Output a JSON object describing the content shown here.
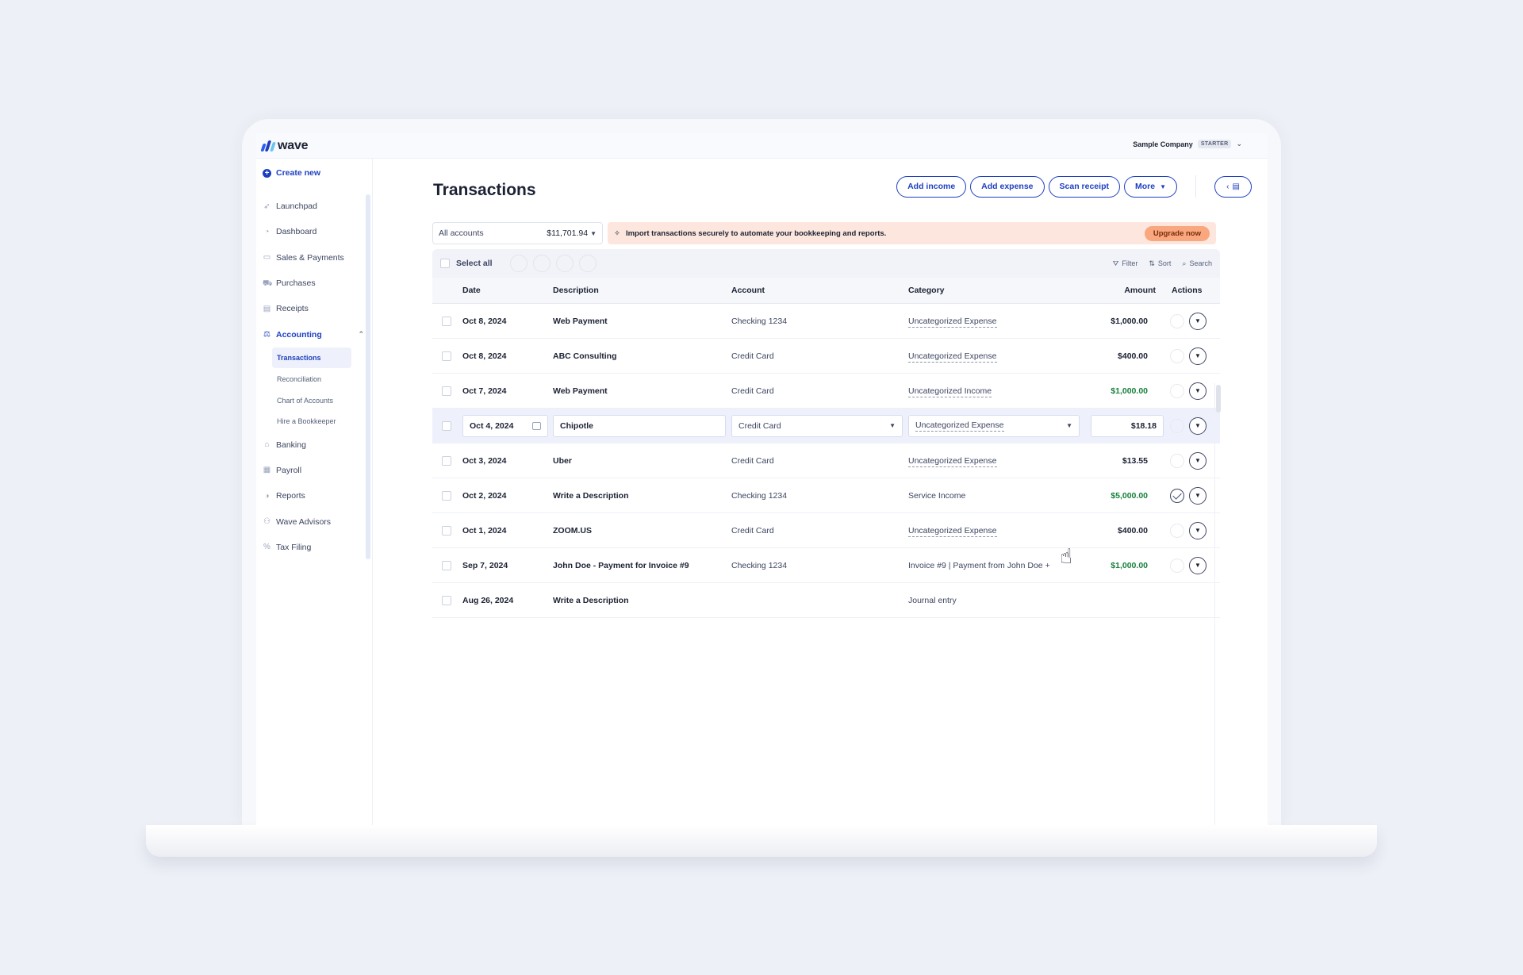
{
  "app": {
    "logo_text": "wave",
    "company": "Sample Company",
    "plan_badge": "STARTER"
  },
  "colors": {
    "accent": "#1d3fbf",
    "income_green": "#17803d",
    "banner_bg": "#fde6dd",
    "upgrade_bg": "#f9a77e"
  },
  "sidebar": {
    "create_new": "Create new",
    "items": [
      {
        "label": "Launchpad",
        "icon": "rocket-icon"
      },
      {
        "label": "Dashboard",
        "icon": "gauge-icon"
      },
      {
        "label": "Sales & Payments",
        "icon": "card-icon"
      },
      {
        "label": "Purchases",
        "icon": "cart-icon"
      },
      {
        "label": "Receipts",
        "icon": "receipt-icon"
      },
      {
        "label": "Accounting",
        "icon": "scale-icon",
        "expanded": true
      }
    ],
    "sub_items": [
      {
        "label": "Transactions",
        "active": true
      },
      {
        "label": "Reconciliation"
      },
      {
        "label": "Chart of Accounts"
      },
      {
        "label": "Hire a Bookkeeper"
      }
    ],
    "items_after": [
      {
        "label": "Banking",
        "icon": "bank-icon"
      },
      {
        "label": "Payroll",
        "icon": "clipboard-icon"
      },
      {
        "label": "Reports",
        "icon": "chart-icon"
      },
      {
        "label": "Wave Advisors",
        "icon": "people-icon"
      },
      {
        "label": "Tax Filing",
        "icon": "percent-icon"
      }
    ]
  },
  "header": {
    "title": "Transactions",
    "buttons": {
      "add_income": "Add income",
      "add_expense": "Add expense",
      "scan_receipt": "Scan receipt",
      "more": "More"
    }
  },
  "filters": {
    "account": "All accounts",
    "balance": "$11,701.94"
  },
  "banner": {
    "text": "Import transactions securely to automate your bookkeeping and reports.",
    "cta": "Upgrade now"
  },
  "table": {
    "select_all": "Select all",
    "tools": {
      "filter": "Filter",
      "sort": "Sort",
      "search": "Search"
    },
    "columns": {
      "date": "Date",
      "description": "Description",
      "account": "Account",
      "category": "Category",
      "amount": "Amount",
      "actions": "Actions"
    },
    "rows": [
      {
        "date": "Oct 8, 2024",
        "description": "Web Payment",
        "account": "Checking 1234",
        "category": "Uncategorized Expense",
        "amount": "$1,000.00",
        "income": false
      },
      {
        "date": "Oct 8, 2024",
        "description": "ABC Consulting",
        "account": "Credit Card",
        "category": "Uncategorized Expense",
        "amount": "$400.00",
        "income": false
      },
      {
        "date": "Oct 7, 2024",
        "description": "Web Payment",
        "account": "Credit Card",
        "category": "Uncategorized Income",
        "amount": "$1,000.00",
        "income": true
      },
      {
        "date": "Oct 4, 2024",
        "description": "Chipotle",
        "account": "Credit Card",
        "category": "Uncategorized Expense",
        "amount": "$18.18",
        "income": false,
        "editing": true
      },
      {
        "date": "Oct 3, 2024",
        "description": "Uber",
        "account": "Credit Card",
        "category": "Uncategorized Expense",
        "amount": "$13.55",
        "income": false
      },
      {
        "date": "Oct 2, 2024",
        "description": "Write a Description",
        "account": "Checking 1234",
        "category": "Service Income",
        "amount": "$5,000.00",
        "income": true,
        "reviewed": true
      },
      {
        "date": "Oct 1, 2024",
        "description": "ZOOM.US",
        "account": "Credit Card",
        "category": "Uncategorized Expense",
        "amount": "$400.00",
        "income": false
      },
      {
        "date": "Sep 7, 2024",
        "description": "John Doe - Payment for Invoice #9",
        "account": "Checking 1234",
        "category": "Invoice #9 | Payment from John Doe +",
        "amount": "$1,000.00",
        "income": true
      },
      {
        "date": "Aug 26, 2024",
        "description": "Write a Description",
        "account": "",
        "category": "Journal entry",
        "amount": "",
        "income": false
      }
    ]
  }
}
